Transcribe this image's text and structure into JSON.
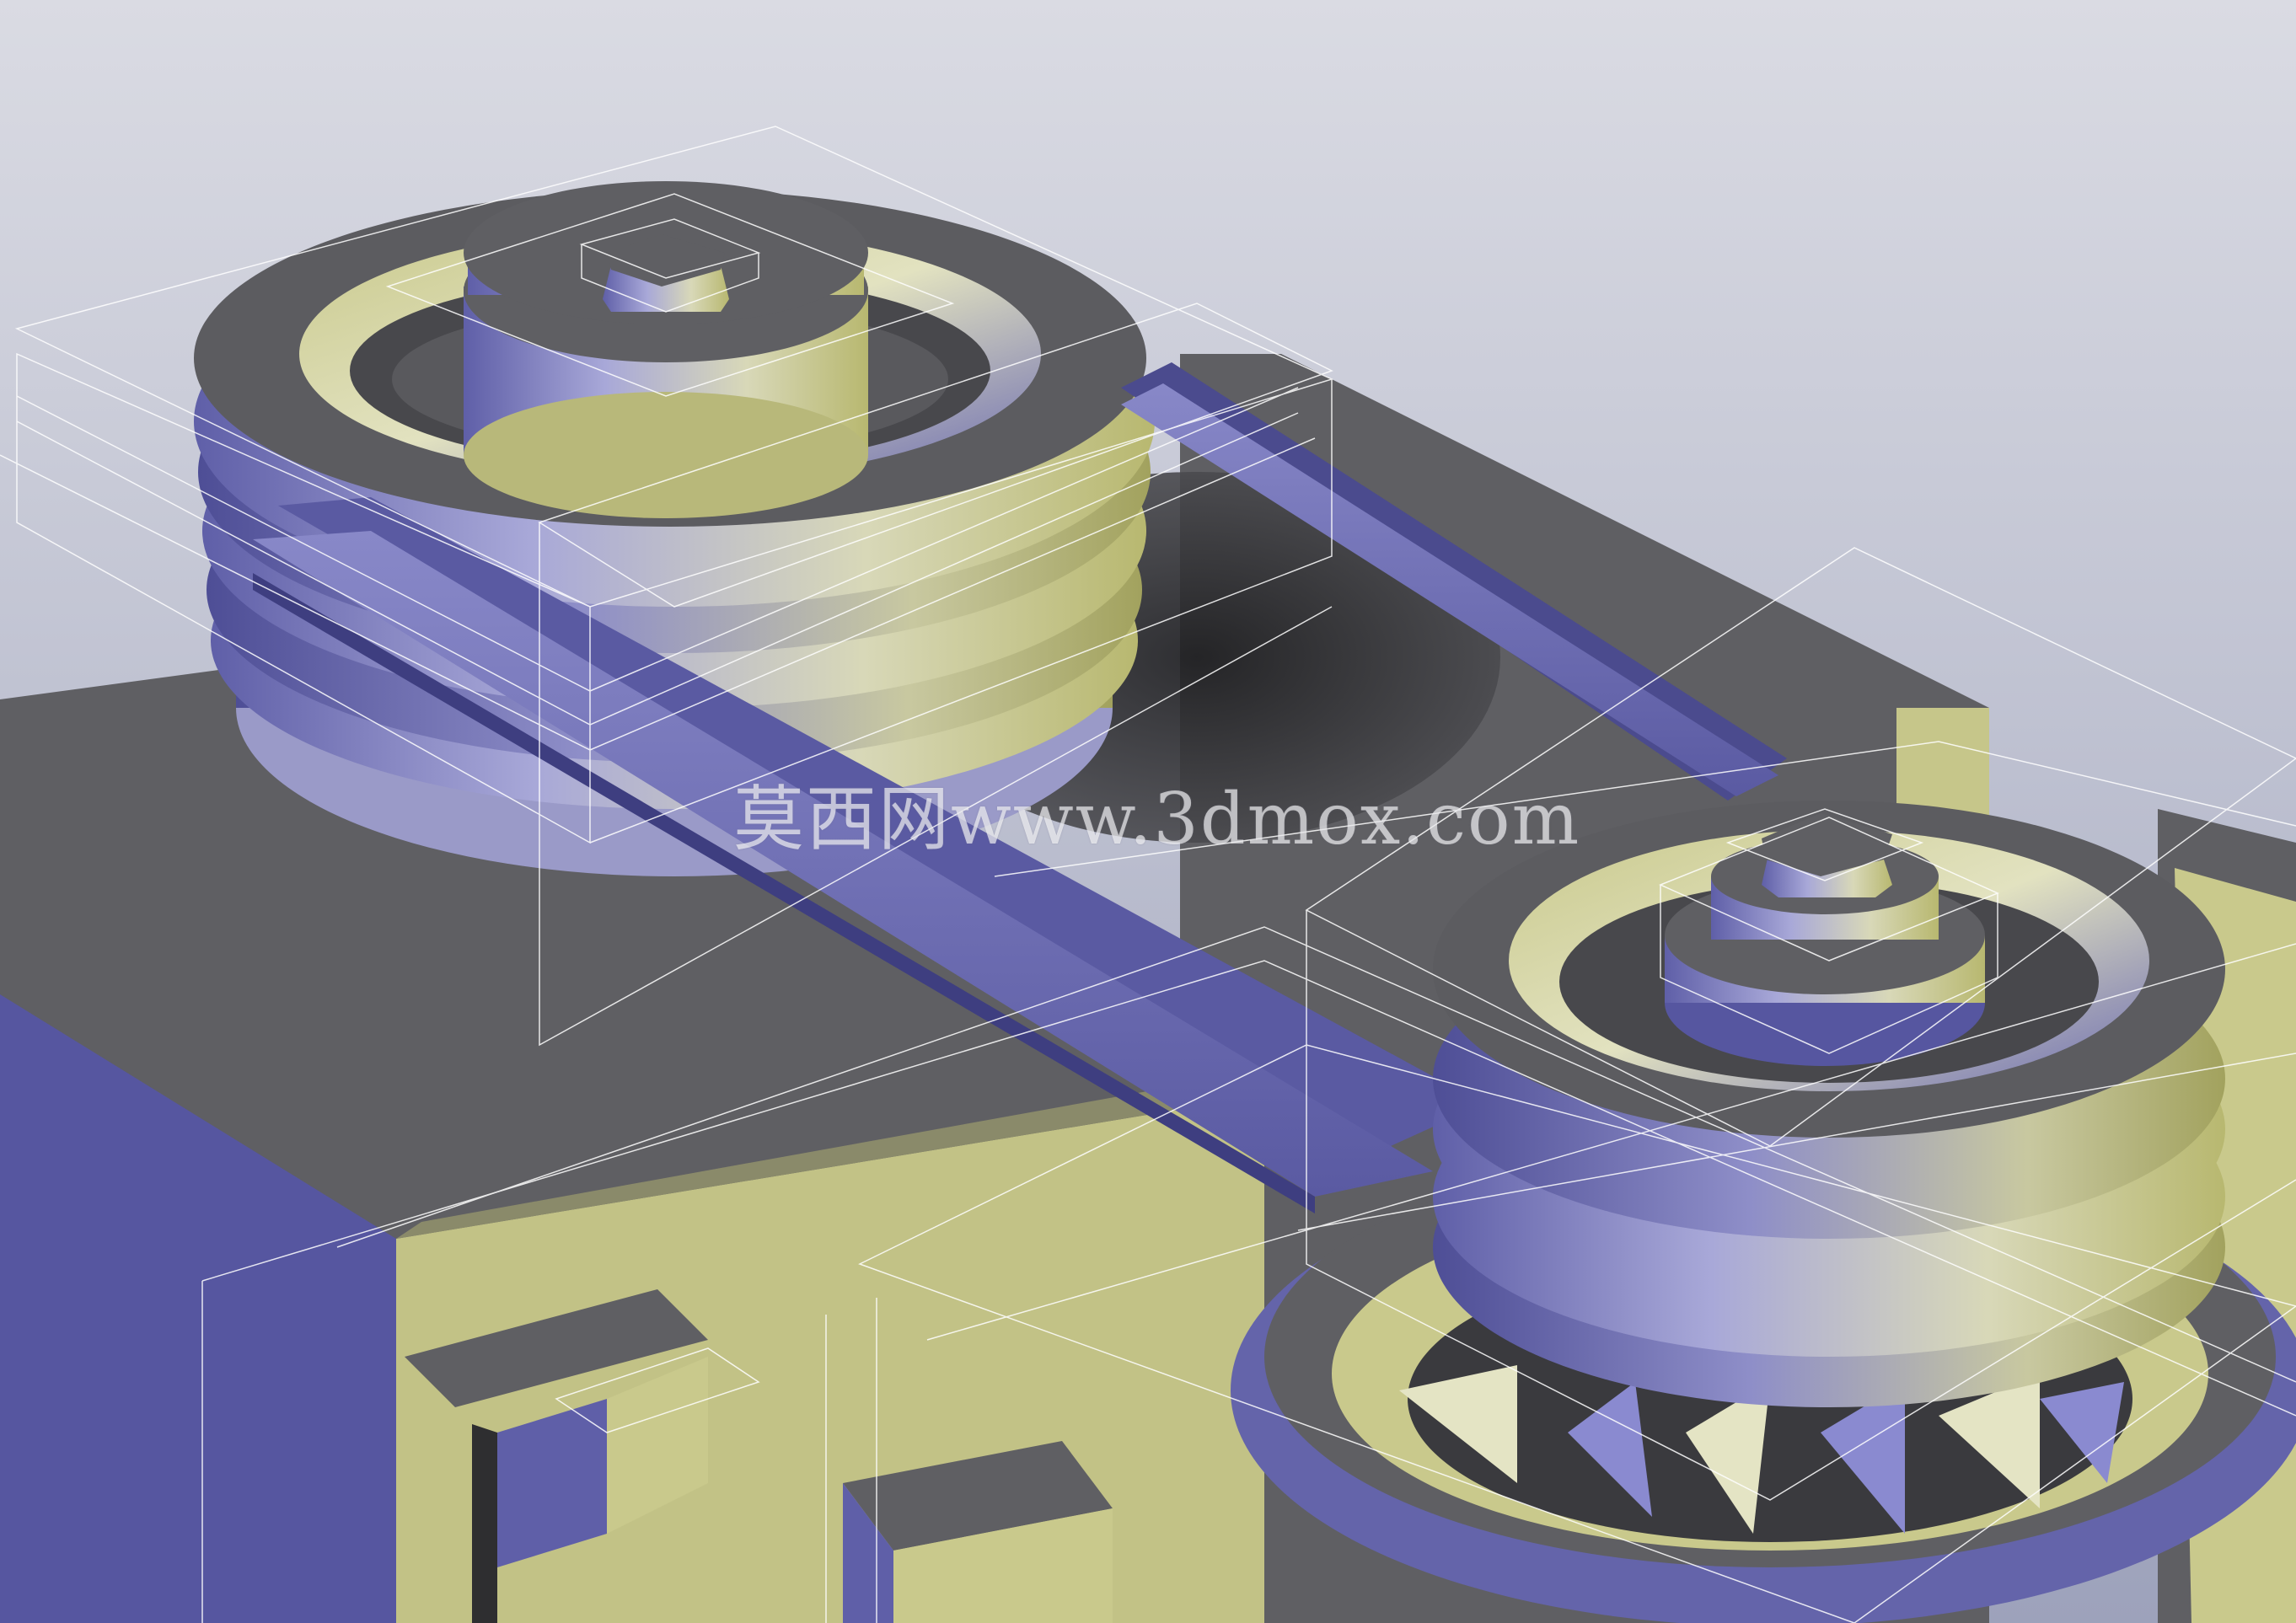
{
  "viewport": {
    "background_top": "#d8d9e2",
    "background_bottom": "#9aa0b8",
    "watermark": "莫西网www.3dmox.com"
  },
  "colors": {
    "gray_surface": "#5f5f63",
    "dark_surface": "#2e2e30",
    "blue_violet": "#5f5fa8",
    "light_violet": "#9c9cd6",
    "yellow_green": "#c9c98c",
    "olive": "#a9a96a",
    "wire_box": "#ffffff"
  },
  "model": {
    "parts": [
      "large-pulley",
      "small-pulley",
      "drive-belt",
      "hex-bolt-large",
      "hex-bolt-small",
      "gear-housing",
      "base-block",
      "motor-fan"
    ]
  }
}
